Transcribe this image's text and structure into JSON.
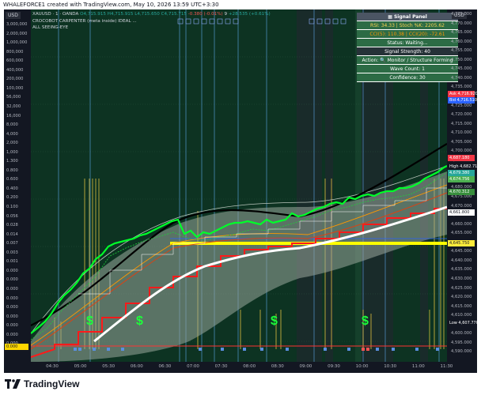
{
  "header": {
    "caption": "WHALEFORCE1 created with TradingView.com, May 10, 2026 13:59 UTC+3:30"
  },
  "legend": {
    "symbol": "XAUUSD · 1 · OANDA",
    "open": "O4,715.915",
    "high": "H4,715.915",
    "low": "L4,715.650",
    "close": "C4,715.715",
    "change": "-0.380 (-0.01%)",
    "volume": "9",
    "extra": "+28.535 (+0.61%)",
    "indicator_1": "CROCOBOT CARPENTER (meta inside) IDEAL ...",
    "indicator_2": "ALL SEEING-EYE"
  },
  "signal_panel": {
    "title": "Signal Panel",
    "rsi_line": "RSI: 34.33 | Stoch %K: 2205.62",
    "cci_line": "CCI(5): 110.38 | CCI(20): -72.61",
    "status": "Status: Waiting...",
    "strength": "Signal Strength: 40",
    "action": "Action: 🔍 Monitor / Structure Forming",
    "wave": "Wave Count: 1",
    "confidence": "Confidence: 30"
  },
  "left_axis": {
    "currency": "USD",
    "labels": [
      "3,000,000",
      "2,000,000",
      "1,000,000",
      "800,000",
      "600,000",
      "400,000",
      "200,000",
      "100,000",
      "56,000",
      "32,000",
      "16,000",
      "8,000",
      "4,000",
      "2,000",
      "1,000",
      "1.300",
      "0.800",
      "0.600",
      "0.400",
      "0.200",
      "0.100",
      "0.056",
      "0.028",
      "0.014",
      "0.007",
      "0.003",
      "0.001",
      "0.000",
      "0.000",
      "0.000",
      "0.000",
      "0.000",
      "0.000",
      "0.000",
      "0.000",
      "0.000"
    ],
    "tag_value": "0.000"
  },
  "right_axis": {
    "currency": "USD",
    "labels": [
      "4,775.000",
      "4,770.000",
      "4,765.000",
      "4,760.000",
      "4,755.000",
      "4,750.000",
      "4,745.000",
      "4,740.000",
      "4,735.000",
      "4,730.000",
      "4,725.000",
      "4,720.000",
      "4,715.000",
      "4,710.000",
      "4,705.000",
      "4,700.000",
      "4,695.000",
      "4,690.000",
      "4,685.000",
      "4,680.000",
      "4,675.000",
      "4,670.000",
      "4,665.000",
      "4,660.000",
      "4,655.000",
      "4,650.000",
      "4,645.000",
      "4,640.000",
      "4,635.000",
      "4,630.000",
      "4,625.000",
      "4,620.000",
      "4,615.000",
      "4,610.000",
      "4,605.000",
      "4,600.000",
      "4,595.000",
      "4,590.000"
    ],
    "tags": [
      {
        "label": "Ask 4,716.920",
        "color": "#f23645"
      },
      {
        "label": "Bid 4,716.510",
        "color": "#2962ff"
      },
      {
        "label": "4,687.180",
        "color": "#f23645"
      },
      {
        "label": "High 4,682.715",
        "color": "#131722"
      },
      {
        "label": "4,679.380",
        "color": "#26a69a"
      },
      {
        "label": "4,674.756",
        "color": "#4caf50"
      },
      {
        "label": "4,670.312",
        "color": "#388e3c"
      },
      {
        "label": "4,661.800",
        "color": "#ffffff"
      },
      {
        "label": "4,645.750",
        "color": "#ffeb3b"
      },
      {
        "label": "Low 4,607.770",
        "color": "#131722"
      }
    ]
  },
  "time_axis": {
    "ticks": [
      "04:30",
      "05:00",
      "05:30",
      "06:00",
      "06:30",
      "07:00",
      "07:30",
      "08:00",
      "08:30",
      "09:00",
      "09:30",
      "10:00",
      "10:30",
      "11:00",
      "11:30"
    ]
  },
  "markers": {
    "dollar": "$"
  },
  "branding": {
    "name": "TradingView"
  },
  "colors": {
    "background": "#0b2a1e",
    "candles_up": "#00ff2a",
    "band_fill": "#9aa79c",
    "ema_white": "#ffffff",
    "ema_black": "#000000",
    "supertrend_red": "#ff1a1a",
    "support_yellow": "#ffff00"
  }
}
